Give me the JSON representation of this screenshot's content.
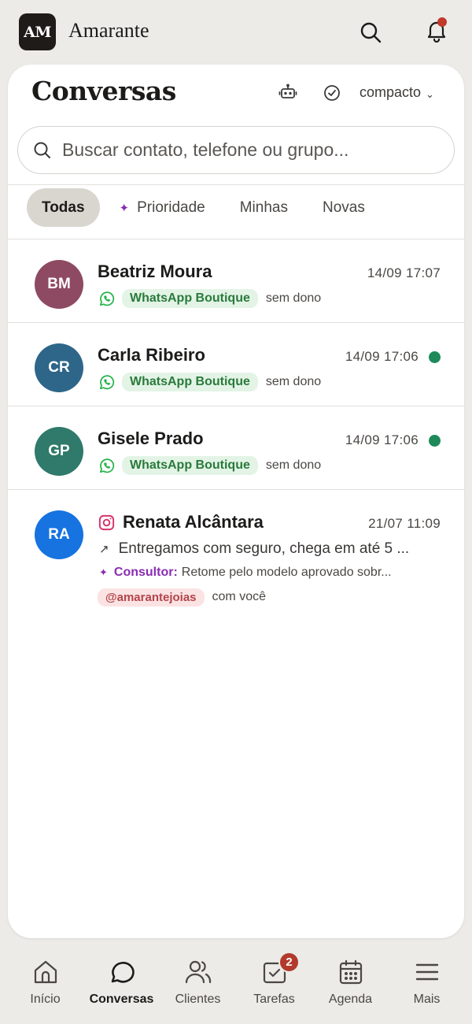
{
  "header": {
    "logo_text": "AM",
    "brand": "Amarante"
  },
  "page": {
    "title": "Conversas",
    "density_label": "compacto"
  },
  "search": {
    "placeholder": "Buscar contato, telefone ou grupo..."
  },
  "filters": [
    {
      "label": "Todas",
      "active": true
    },
    {
      "label": "Prioridade",
      "icon": "sparkle-icon"
    },
    {
      "label": "Minhas"
    },
    {
      "label": "Novas"
    }
  ],
  "conversations": [
    {
      "initials": "BM",
      "avatar_color": "#8e4a62",
      "name": "Beatriz Moura",
      "time": "14/09 17:07",
      "unread": false,
      "channel": "WhatsApp Boutique",
      "owner": "sem dono"
    },
    {
      "initials": "CR",
      "avatar_color": "#2e6689",
      "name": "Carla Ribeiro",
      "time": "14/09 17:06",
      "unread": true,
      "channel": "WhatsApp Boutique",
      "owner": "sem dono"
    },
    {
      "initials": "GP",
      "avatar_color": "#2f7a6a",
      "name": "Gisele Prado",
      "time": "14/09 17:06",
      "unread": true,
      "channel": "WhatsApp Boutique",
      "owner": "sem dono"
    },
    {
      "initials": "RA",
      "avatar_color": "#1673e0",
      "name": "Renata Alcântara",
      "time": "21/07 11:09",
      "channel_icon": "instagram-icon",
      "preview": "Entregamos com seguro, chega em até 5 ...",
      "consultant_label": "Consultor:",
      "consultant_msg": "Retome pelo modelo aprovado sobr...",
      "handle": "@amarantejoias",
      "owner": "com você"
    }
  ],
  "nav": [
    {
      "label": "Início",
      "icon": "home-icon"
    },
    {
      "label": "Conversas",
      "icon": "chat-icon",
      "active": true
    },
    {
      "label": "Clientes",
      "icon": "users-icon"
    },
    {
      "label": "Tarefas",
      "icon": "tasks-icon",
      "badge": "2"
    },
    {
      "label": "Agenda",
      "icon": "calendar-icon"
    },
    {
      "label": "Mais",
      "icon": "menu-icon"
    }
  ],
  "colors": {
    "accent_purple": "#8a2db4",
    "whatsapp_green": "#25b34a",
    "unread_dot": "#1e8a5a",
    "badge_red": "#b23a2c",
    "instagram": "#d6336c"
  }
}
